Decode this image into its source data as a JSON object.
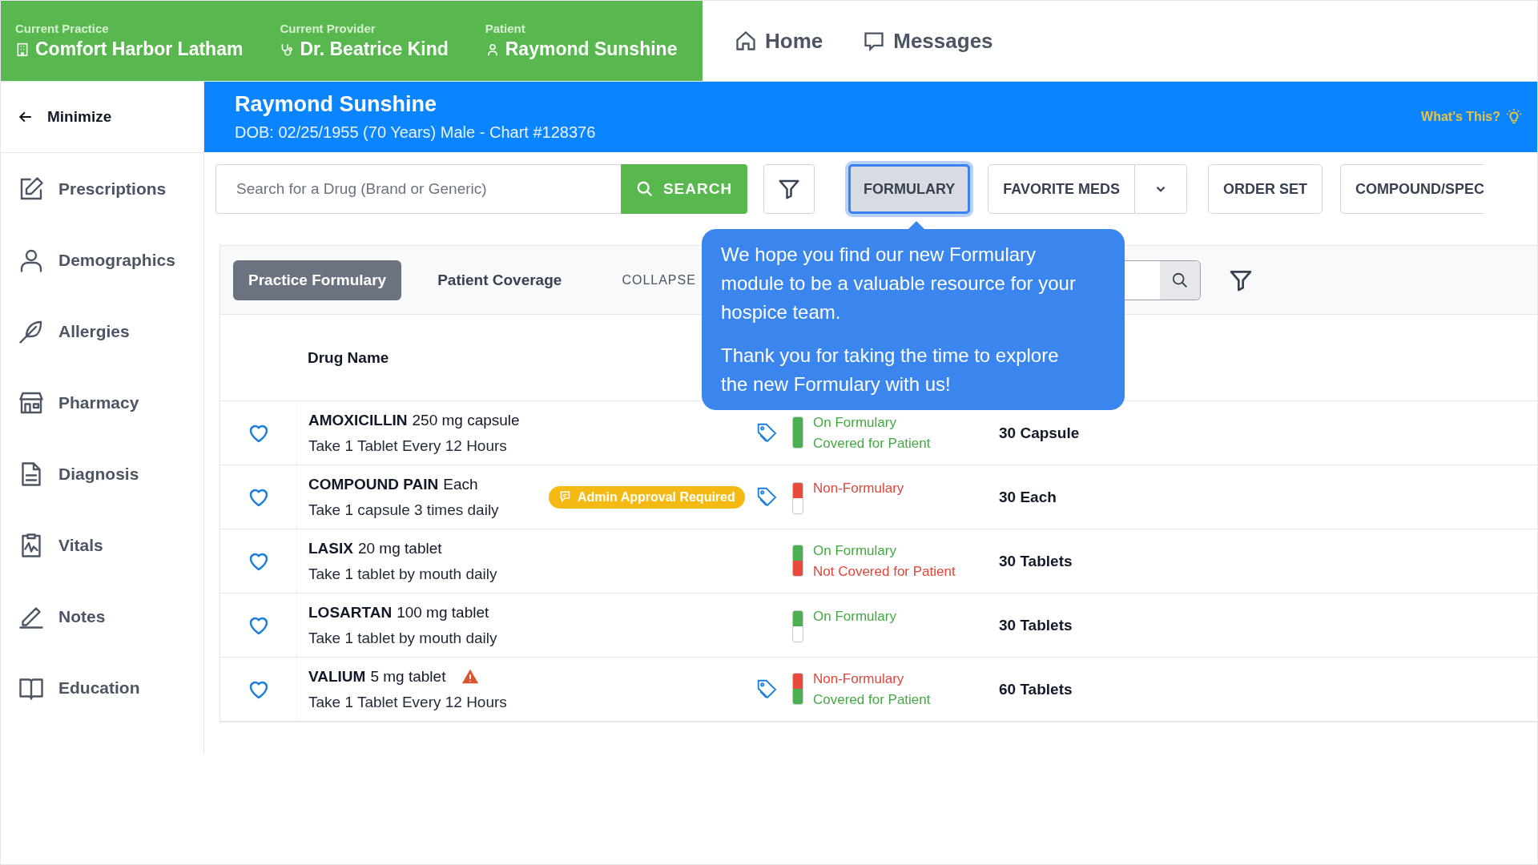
{
  "header": {
    "fields": [
      {
        "label": "Current Practice",
        "value": "Comfort Harbor Latham"
      },
      {
        "label": "Current Provider",
        "value": "Dr. Beatrice Kind"
      },
      {
        "label": "Patient",
        "value": "Raymond Sunshine"
      }
    ],
    "nav": [
      "Home",
      "Messages"
    ]
  },
  "sidebar": {
    "minimize": "Minimize",
    "items": [
      "Prescriptions",
      "Demographics",
      "Allergies",
      "Pharmacy",
      "Diagnosis",
      "Vitals",
      "Notes",
      "Education"
    ]
  },
  "patient": {
    "name": "Raymond Sunshine",
    "details": "DOB: 02/25/1955 (70 Years) Male - Chart #128376",
    "help": "What's This?"
  },
  "toolbar": {
    "search": {
      "placeholder": "Search for a Drug (Brand or Generic)"
    },
    "search_button": "SEARCH",
    "buttons": [
      {
        "label": "FORMULARY",
        "selected": true,
        "dropdown": false
      },
      {
        "label": "FAVORITE MEDS",
        "selected": false,
        "dropdown": true
      },
      {
        "label": "ORDER SET",
        "selected": false,
        "dropdown": false
      },
      {
        "label": "COMPOUND/SPEC",
        "selected": false,
        "dropdown": false
      }
    ]
  },
  "formulary": {
    "tabs": [
      {
        "label": "Practice Formulary",
        "selected": true
      },
      {
        "label": "Patient Coverage",
        "selected": false
      }
    ],
    "collapse": "COLLAPSE",
    "column": "Drug Name",
    "rows": [
      {
        "name": "AMOXICILLIN",
        "strength": "250 mg capsule",
        "sig": "Take 1 Tablet Every 12 Hours",
        "tag": true,
        "warning": false,
        "formulary_status": "On Formulary",
        "on_formulary": true,
        "coverage_status": "Covered for Patient",
        "covered": true,
        "quantity": "30 Capsule"
      },
      {
        "name": "COMPOUND PAIN",
        "strength": "Each",
        "sig": "Take 1 capsule 3 times daily",
        "badge": "Admin Approval Required",
        "tag": true,
        "warning": false,
        "formulary_status": "Non-Formulary",
        "on_formulary": false,
        "quantity": "30 Each"
      },
      {
        "name": "LASIX",
        "strength": "20 mg tablet",
        "sig": "Take 1 tablet by mouth daily",
        "tag": false,
        "warning": false,
        "formulary_status": "On Formulary",
        "on_formulary": true,
        "coverage_status": "Not Covered for Patient",
        "covered": false,
        "quantity": "30 Tablets"
      },
      {
        "name": "LOSARTAN",
        "strength": "100 mg tablet",
        "sig": "Take 1 tablet by mouth daily",
        "tag": false,
        "warning": false,
        "formulary_status": "On Formulary",
        "on_formulary": true,
        "quantity": "30 Tablets"
      },
      {
        "name": "VALIUM",
        "strength": "5 mg tablet",
        "sig": "Take 1 Tablet Every 12 Hours",
        "tag": true,
        "warning": true,
        "formulary_status": "Non-Formulary",
        "on_formulary": false,
        "coverage_status": "Covered for Patient",
        "covered": true,
        "quantity": "60 Tablets"
      }
    ]
  },
  "tooltip": {
    "paragraphs": [
      "We hope you find our new Formulary module to be a valuable resource for your hospice team.",
      "Thank you for taking the time to explore the new Formulary with us!"
    ]
  }
}
